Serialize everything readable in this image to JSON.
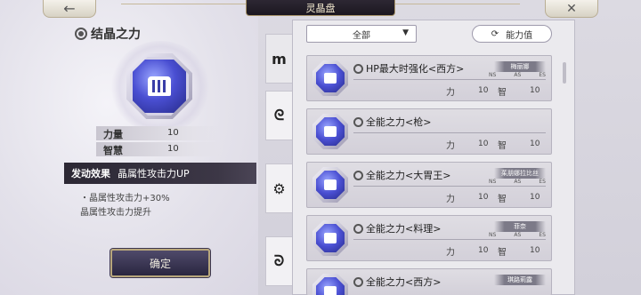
{
  "header": {
    "title": "灵晶盘",
    "back_icon": "←",
    "close_icon": "✕"
  },
  "left": {
    "title": "结晶之力",
    "stats": [
      {
        "label": "力量",
        "value": "10"
      },
      {
        "label": "智慧",
        "value": "10"
      }
    ],
    "effect_tag": "发动效果",
    "effect_name": "晶属性攻击力UP",
    "effect_desc_1": "・晶属性攻击力+30%",
    "effect_desc_2": "晶属性攻击力提升",
    "confirm": "确定"
  },
  "filter": {
    "dropdown_label": "全部",
    "dropdown_arrow": "▼",
    "sort_label": "能力值",
    "sort_icon": "⟳"
  },
  "tabs": [
    {
      "icon": "crystal-icon",
      "glyph": "m"
    },
    {
      "icon": "swirl-icon",
      "glyph": "ᘓ"
    },
    {
      "icon": "gear-icon",
      "glyph": "⚙"
    },
    {
      "icon": "wave-icon",
      "glyph": "ᘐ"
    }
  ],
  "cards": [
    {
      "name": "HP最大时强化<西方>",
      "character": "梅丽娜",
      "tags": [
        "NS",
        "AS",
        "ES"
      ],
      "str_label": "力",
      "str": "10",
      "wis_label": "智",
      "wis": "10"
    },
    {
      "name": "全能之力<枪>",
      "character": "",
      "tags": [],
      "str_label": "力",
      "str": "10",
      "wis_label": "智",
      "wis": "10"
    },
    {
      "name": "全能之力<大胃王>",
      "character": "茱朋娜拉比丝",
      "tags": [
        "NS",
        "AS",
        "ES"
      ],
      "str_label": "力",
      "str": "10",
      "wis_label": "智",
      "wis": "10"
    },
    {
      "name": "全能之力<料理>",
      "character": "菲奈",
      "tags": [
        "NS",
        "AS",
        "ES"
      ],
      "str_label": "力",
      "str": "10",
      "wis_label": "智",
      "wis": "10"
    },
    {
      "name": "全能之力<西方>",
      "character": "琪路莉露",
      "tags": [],
      "str_label": "",
      "str": "",
      "wis_label": "",
      "wis": ""
    }
  ]
}
